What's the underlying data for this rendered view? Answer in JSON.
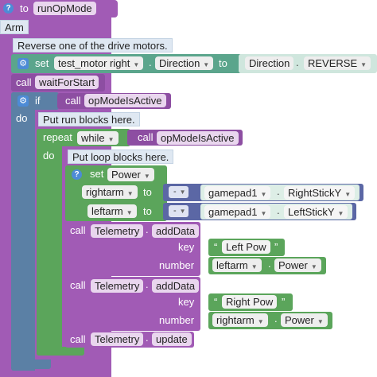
{
  "function_block": {
    "name": "runOpMode",
    "to_label": "to"
  },
  "comment_arm": "Arm",
  "comment_reverse": "Reverse one of the drive motors.",
  "set_direction": {
    "set_label": "set",
    "motor": "test_motor right",
    "property": "Direction",
    "to_label": "to",
    "enum_type": "Direction",
    "enum_value": "REVERSE"
  },
  "wait_block": {
    "call_label": "call",
    "method": "waitForStart"
  },
  "if_block": {
    "if_label": "if",
    "do_label": "do",
    "call_label": "call",
    "condition": "opModeIsActive",
    "comment": "Put run blocks here."
  },
  "repeat_block": {
    "repeat_label": "repeat",
    "mode": "while",
    "do_label": "do",
    "call_label": "call",
    "condition": "opModeIsActive",
    "comment": "Put loop blocks here."
  },
  "set_power": {
    "set_label": "set",
    "property": "Power",
    "rows": [
      {
        "motor": "rightarm",
        "to_label": "to",
        "op": "-",
        "gamepad": "gamepad1",
        "stick": "RightStickY"
      },
      {
        "motor": "leftarm",
        "to_label": "to",
        "op": "-",
        "gamepad": "gamepad1",
        "stick": "LeftStickY"
      }
    ]
  },
  "telemetry_1": {
    "call_label": "call",
    "object": "Telemetry",
    "method": "addData",
    "key_label": "key",
    "key_value": "Left Pow",
    "number_label": "number",
    "motor": "leftarm",
    "property": "Power"
  },
  "telemetry_2": {
    "call_label": "call",
    "object": "Telemetry",
    "method": "addData",
    "key_label": "key",
    "key_value": "Right Pow",
    "number_label": "number",
    "motor": "rightarm",
    "property": "Power"
  },
  "telemetry_3": {
    "call_label": "call",
    "object": "Telemetry",
    "method": "update"
  }
}
